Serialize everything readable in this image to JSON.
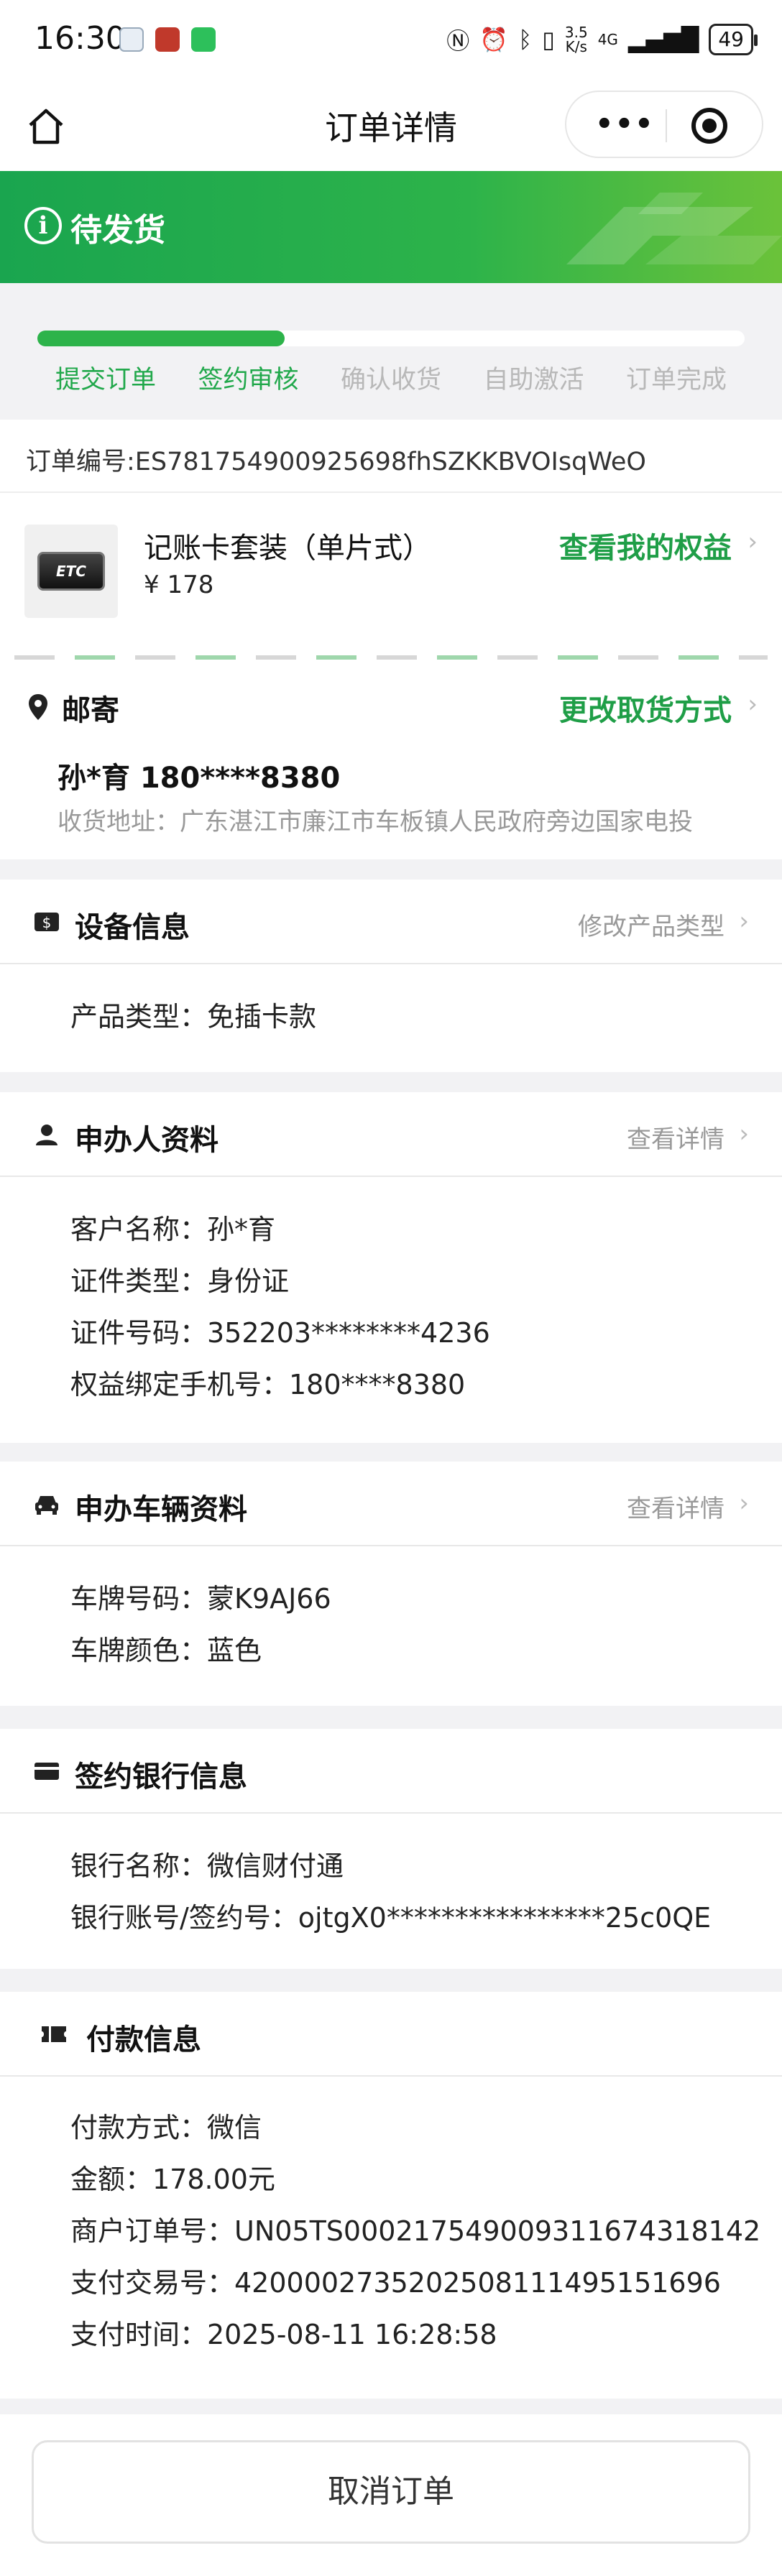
{
  "status_bar": {
    "time": "16:30",
    "net_speed_top": "3.5",
    "net_speed_bottom": "K/s",
    "network": "4G",
    "battery": "49"
  },
  "nav": {
    "title": "订单详情",
    "capsule_dots": "•••"
  },
  "banner": {
    "icon": "i",
    "status": "待发货"
  },
  "progress": {
    "fraction": 0.35,
    "steps": [
      {
        "label": "提交订单",
        "done": true
      },
      {
        "label": "签约审核",
        "done": true
      },
      {
        "label": "确认收货",
        "done": false
      },
      {
        "label": "自助激活",
        "done": false
      },
      {
        "label": "订单完成",
        "done": false
      }
    ]
  },
  "order": {
    "number": "订单编号:ES781754900925698fhSZKKBVOIsqWeO"
  },
  "product": {
    "image_text": "ETC",
    "name": "记账卡套装（单片式）",
    "price": "¥ 178",
    "link": "查看我的权益"
  },
  "shipping": {
    "title": "邮寄",
    "link": "更改取货方式",
    "person": "孙*育 180****8380",
    "address": "收货地址：广东湛江市廉江市车板镇人民政府旁边国家电投"
  },
  "device": {
    "title": "设备信息",
    "link": "修改产品类型",
    "rows": [
      "产品类型：免插卡款"
    ]
  },
  "applicant": {
    "title": "申办人资料",
    "link": "查看详情",
    "rows": [
      "客户名称：孙*育",
      "证件类型：身份证",
      "证件号码：352203********4236",
      "权益绑定手机号：180****8380"
    ]
  },
  "vehicle": {
    "title": "申办车辆资料",
    "link": "查看详情",
    "rows": [
      "车牌号码：蒙K9AJ66",
      "车牌颜色：蓝色"
    ]
  },
  "bank": {
    "title": "签约银行信息",
    "rows": [
      "银行名称：微信财付通",
      "银行账号/签约号：ojtgX0****************25c0QE"
    ]
  },
  "payment": {
    "title": "付款信息",
    "rows": [
      "付款方式：微信",
      "金额：178.00元",
      "商户订单号：UN05TS00021754900931167431814​2",
      "支付交易号：4200002735202508111495151696",
      "支付时间：2025-08-11 16:28:58"
    ]
  },
  "cancel": {
    "label": "取消订单"
  },
  "colors": {
    "accent": "#2db34a",
    "accent_text": "#1f9e47",
    "muted": "#b8b8b8"
  }
}
